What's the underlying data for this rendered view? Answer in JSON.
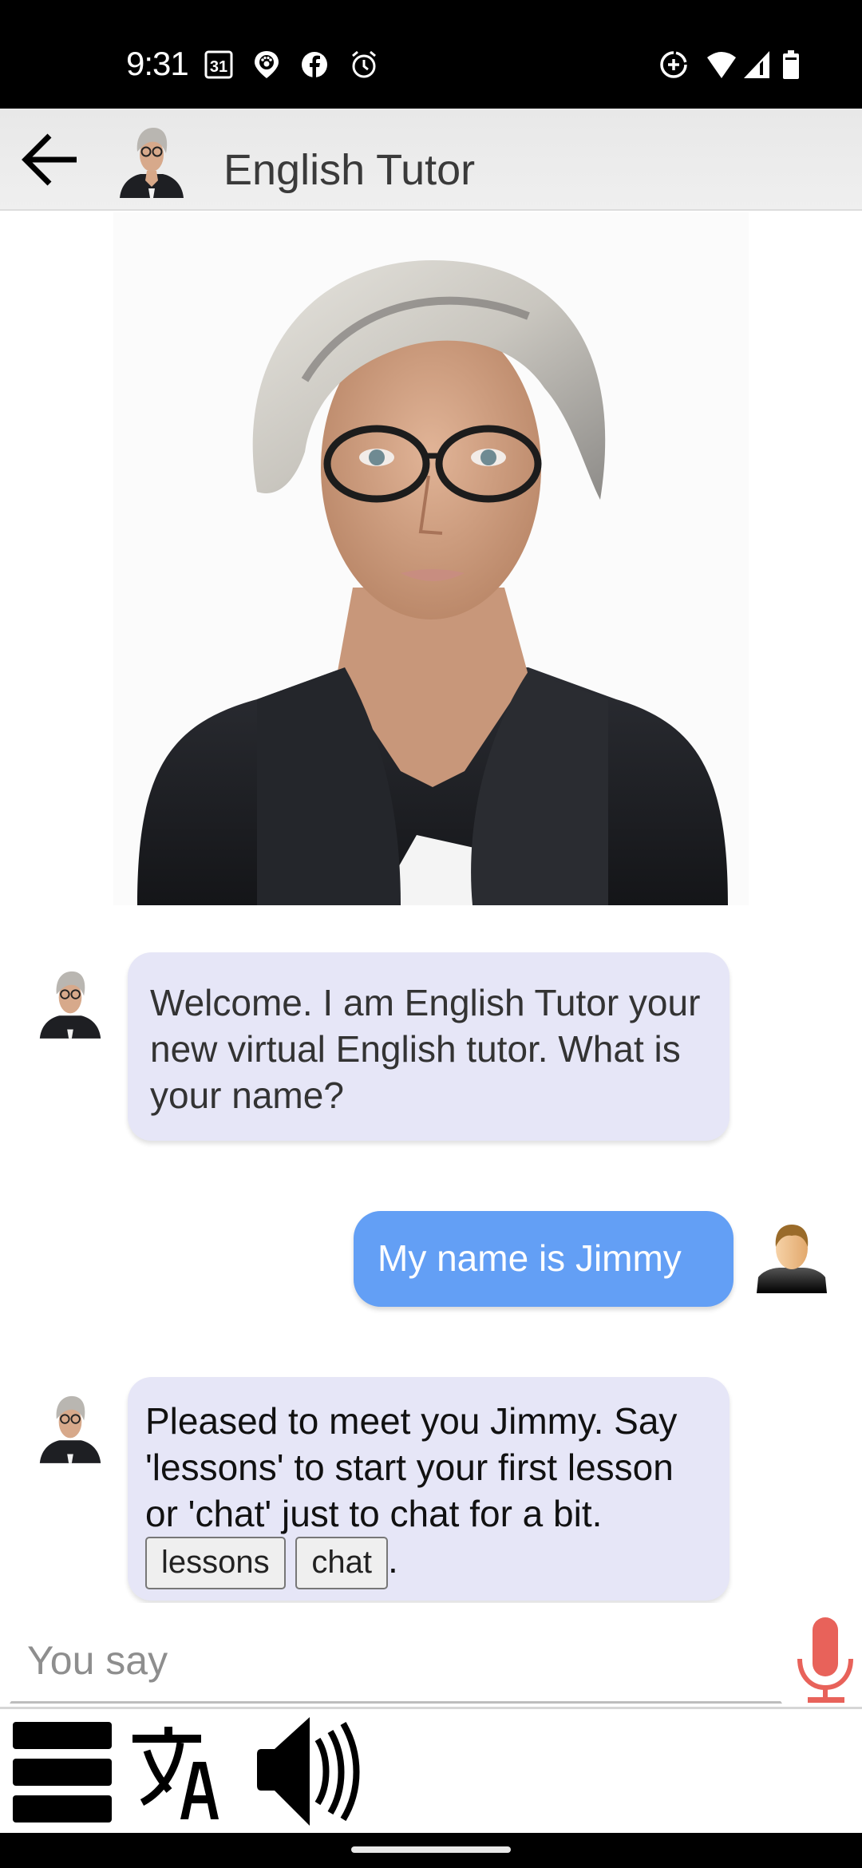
{
  "status_bar": {
    "time": "9:31",
    "calendar_day": "31",
    "left_icons": [
      "calendar-icon",
      "pet-location-icon",
      "facebook-icon",
      "alarm-icon"
    ],
    "right_icons": [
      "data-saver-icon",
      "wifi-icon",
      "cell-signal-icon",
      "battery-icon"
    ]
  },
  "app_bar": {
    "title": "English Tutor",
    "back_icon": "arrow-left-icon",
    "avatar": "tutor-avatar"
  },
  "hero": {
    "image": "tutor-portrait"
  },
  "messages": [
    {
      "sender": "bot",
      "text": "Welcome. I am English Tutor your new virtual English tutor. What is your name?"
    },
    {
      "sender": "user",
      "text": "My name is Jimmy"
    },
    {
      "sender": "bot",
      "text": "Pleased to meet you Jimmy. Say 'lessons' to start your first lesson or 'chat' just to chat for a bit.",
      "text_before_buttons": "Pleased to meet you Jimmy. Say 'lessons' to start your first lesson or 'chat' just to chat for a bit.",
      "buttons": [
        "lessons",
        "chat"
      ],
      "text_after_buttons": "."
    }
  ],
  "input": {
    "value": "",
    "placeholder": "You say",
    "mic_icon": "microphone-icon",
    "mic_color": "#e8625a"
  },
  "toolbar": {
    "items": [
      "menu-icon",
      "translate-icon",
      "speaker-icon"
    ]
  },
  "colors": {
    "bot_bubble": "#e6e6f7",
    "user_bubble": "#639ff5",
    "app_bar": "#ececec"
  }
}
